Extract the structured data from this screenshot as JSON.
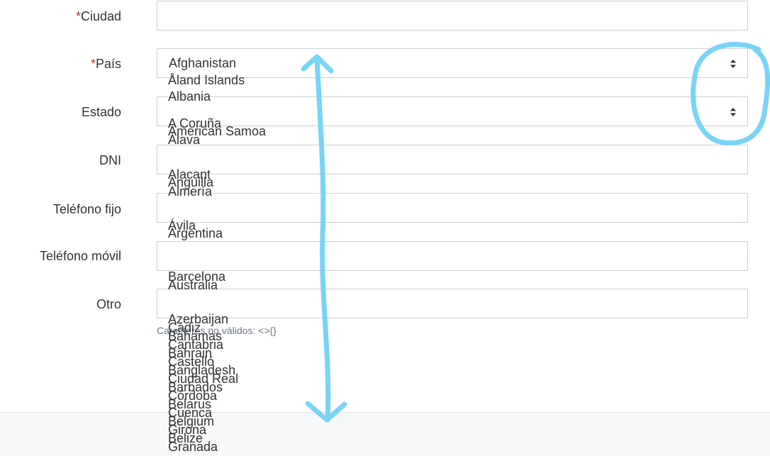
{
  "form": {
    "ciudad": {
      "required_mark": "*",
      "label": "Ciudad",
      "value": ""
    },
    "pais": {
      "required_mark": "*",
      "label": "País",
      "value": "Afghanistan"
    },
    "estado": {
      "label": "Estado",
      "value": ""
    },
    "dni": {
      "label": "DNI",
      "value": ""
    },
    "telefono_fijo": {
      "label": "Teléfono fijo",
      "value": ""
    },
    "telefono_movil": {
      "label": "Teléfono móvil",
      "value": ""
    },
    "otro": {
      "label": "Otro",
      "value": ""
    },
    "hint": "Caracteres no válidos: <>{}"
  },
  "country_options": [
    "Åland Islands",
    "Albania",
    "American Samoa",
    "Anguilla",
    "Argentina",
    "Australia",
    "Azerbaijan",
    "Bahamas",
    "Bahrain",
    "Bangladesh",
    "Barbados",
    "Belarus",
    "Belgium",
    "Belize"
  ],
  "state_options": [
    "A Coruña",
    "Álava",
    "Alacant",
    "Almería",
    "Ávila",
    "Barcelona",
    "Cádiz",
    "Cantabria",
    "Castelló",
    "Ciudad Real",
    "Córdoba",
    "Cuenca",
    "Girona",
    "Granada"
  ],
  "colors": {
    "annotation": "#79d3f7",
    "required": "#b03a2e",
    "border": "#c9d3d8"
  },
  "icons": {
    "select_caret": "sort-caret-icon",
    "annotation_arrow": "double-arrow-icon",
    "annotation_circle": "circle-highlight-icon"
  }
}
